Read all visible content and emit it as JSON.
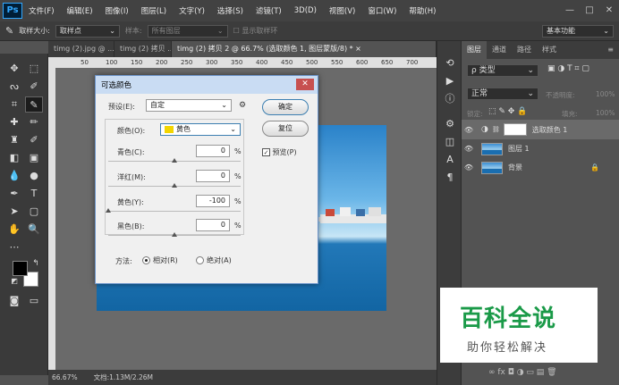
{
  "menubar": {
    "logo": "Ps",
    "items": [
      "文件(F)",
      "编辑(E)",
      "图像(I)",
      "图层(L)",
      "文字(Y)",
      "选择(S)",
      "滤镜(T)",
      "3D(D)",
      "视图(V)",
      "窗口(W)",
      "帮助(H)"
    ],
    "minimize": "—",
    "maximize": "□",
    "close": "✕"
  },
  "options": {
    "sample_size_label": "取样大小:",
    "sample_size_value": "取样点",
    "sample_label": "样本:",
    "sample_value": "所有图层",
    "show_ring": "显示取样环",
    "workspace": "基本功能"
  },
  "tabs": [
    "timg (2).jpg @ ...",
    "timg (2) 拷贝 ...",
    "timg (2) 拷贝 2 @ 66.7% (选取颜色 1, 图层蒙版/8) *"
  ],
  "tabs_close": "×",
  "ruler": [
    "50",
    "100",
    "150",
    "200",
    "250",
    "300",
    "350",
    "400",
    "450",
    "500",
    "550",
    "600",
    "650",
    "700"
  ],
  "status": {
    "zoom": "66.67%",
    "doc": "文档:1.13M/2.26M"
  },
  "dialog": {
    "title": "可选颜色",
    "close": "✕",
    "preset_label": "预设(E):",
    "preset_value": "自定",
    "ok": "确定",
    "reset": "复位",
    "preview": "预览(P)",
    "colors_label": "颜色(O):",
    "colors_value": "黄色",
    "swatch": "#f2d500",
    "sliders": [
      {
        "label": "青色(C):",
        "value": "0",
        "unit": "%",
        "pos": 0.5
      },
      {
        "label": "洋红(M):",
        "value": "0",
        "unit": "%",
        "pos": 0.5
      },
      {
        "label": "黄色(Y):",
        "value": "-100",
        "unit": "%",
        "pos": 0.0
      },
      {
        "label": "黑色(B):",
        "value": "0",
        "unit": "%",
        "pos": 0.5
      }
    ],
    "method_label": "方法:",
    "relative": "相对(R)",
    "absolute": "绝对(A)"
  },
  "layers": {
    "tabs": [
      "图层",
      "通道",
      "路径",
      "样式"
    ],
    "kind": "ρ 类型",
    "blend": "正常",
    "opacity_label": "不透明度:",
    "opacity": "100%",
    "lock_label": "锁定:",
    "fill_label": "填充:",
    "fill": "100%",
    "items": [
      {
        "name": "选取颜色 1"
      },
      {
        "name": "图层 1"
      },
      {
        "name": "背景"
      }
    ],
    "footer": "∞ fx ◘ ◑ ▭ ▤ 🗑"
  },
  "watermark": {
    "title": "百科全说",
    "subtitle": "助你轻松解决"
  },
  "colors": {
    "accent": "#31a8ff",
    "dialog_title_bg": "#c9dcf3",
    "watermark_green": "#1a9a48"
  }
}
